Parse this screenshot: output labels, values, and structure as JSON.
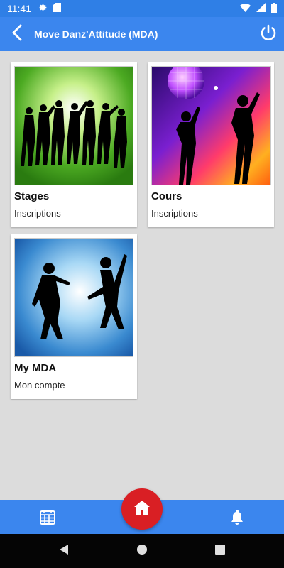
{
  "status_bar": {
    "time": "11:41",
    "icons": [
      "gear-icon",
      "sd-card-icon",
      "wifi-icon",
      "signal-icon",
      "battery-icon"
    ]
  },
  "app_bar": {
    "title": "Move Danz'Attitude (MDA)",
    "back_icon": "chevron-left-icon",
    "power_icon": "power-icon"
  },
  "cards": [
    {
      "title": "Stages",
      "subtitle": "Inscriptions",
      "image": "group-dance-silhouettes-green"
    },
    {
      "title": "Cours",
      "subtitle": "Inscriptions",
      "image": "disco-dancers-silhouettes"
    },
    {
      "title": "My MDA",
      "subtitle": "Mon compte",
      "image": "couple-dance-silhouettes-blue"
    }
  ],
  "bottom_bar": {
    "left_icon": "calendar-icon",
    "center_icon": "home-icon",
    "right_icon": "bell-icon"
  },
  "colors": {
    "primary": "#3b86ee",
    "status": "#2f7fe6",
    "fab": "#d91f24",
    "background": "#dcdcdc"
  }
}
